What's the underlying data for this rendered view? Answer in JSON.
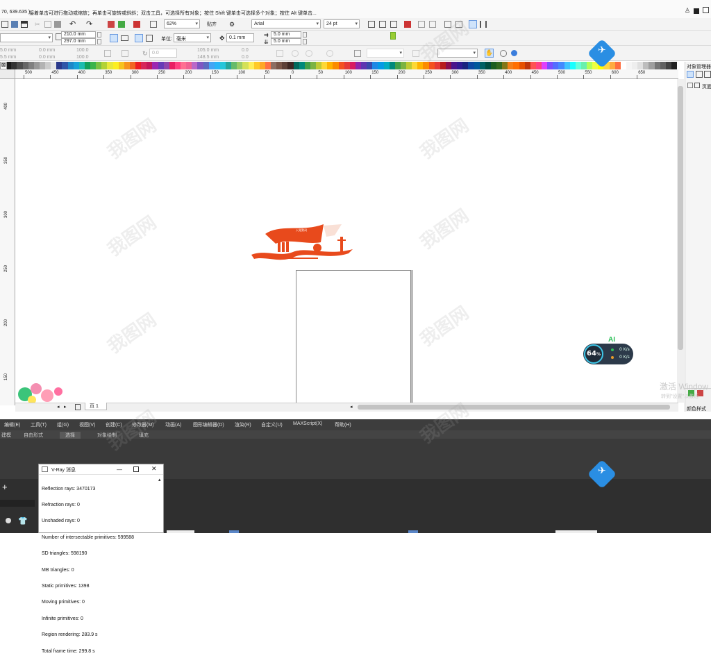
{
  "status_bar": {
    "coords": "70, 639.635 )",
    "hint": "接着单击可进行拖动或缩放；再单击可旋转或斜斜；双击工具，可选择所有对象；按住 Shift 键单击可选择多个对象；按住 Alt 键单击..."
  },
  "toolbar": {
    "zoom": "62%",
    "snap_label": "贴齐",
    "font_name": "Arial",
    "font_size": "24 pt"
  },
  "property_bar": {
    "width": "210.0 mm",
    "height": "297.0 mm",
    "unit_label": "单位:",
    "unit_value": "毫米",
    "nudge": "0.1 mm",
    "dup_x": "5.0 mm",
    "dup_y": "5.0 mm"
  },
  "property_bar2": {
    "val_a": "5.0 mm",
    "val_b": "5.5 mm",
    "val_c": "0.0 mm",
    "val_d": "0.0 mm",
    "val_e": "100.0",
    "val_f": "100.0",
    "val_g": "0.0",
    "val_h": "105.0 mm",
    "val_i": "148.5 mm",
    "val_j": "0.0",
    "val_k": "0.0"
  },
  "ruler_h": [
    "500",
    "450",
    "400",
    "350",
    "300",
    "250",
    "200",
    "150",
    "100",
    "50",
    "0",
    "50",
    "100",
    "150",
    "200",
    "250",
    "300",
    "350",
    "400",
    "450",
    "500",
    "550",
    "600",
    "650"
  ],
  "ruler_v": [
    "400",
    "350",
    "300",
    "250",
    "200",
    "150"
  ],
  "palette_colors": [
    "#000000",
    "#1a1a1a",
    "#333333",
    "#4d4d4d",
    "#666666",
    "#808080",
    "#999999",
    "#b3b3b3",
    "#cccccc",
    "#e6e6e6",
    "#2b3a8c",
    "#3056a8",
    "#1e88c8",
    "#17a2d8",
    "#1bbcb0",
    "#12a15a",
    "#3cb44b",
    "#7cc242",
    "#b2d235",
    "#e8e83a",
    "#fcee21",
    "#f7c31e",
    "#f7941d",
    "#f26522",
    "#ed1c24",
    "#d7265a",
    "#c2185b",
    "#9c27b0",
    "#673ab7",
    "#8e44ad",
    "#e91e63",
    "#ff4081",
    "#ff6f91",
    "#f06292",
    "#ba68c8",
    "#7e57c2",
    "#5c6bc0",
    "#42a5f5",
    "#29b6f6",
    "#26c6da",
    "#26a69a",
    "#66bb6a",
    "#9ccc65",
    "#d4e157",
    "#ffee58",
    "#ffca28",
    "#ffa726",
    "#ff7043",
    "#8d6e63",
    "#795548",
    "#5d4037",
    "#3e2723",
    "#00695c",
    "#00897b",
    "#43a047",
    "#7cb342",
    "#c0ca33",
    "#fdd835",
    "#ffb300",
    "#fb8c00",
    "#f4511e",
    "#e53935",
    "#d81b60",
    "#8e24aa",
    "#5e35b1",
    "#3949ab",
    "#1e88e5",
    "#039be5",
    "#00acc1",
    "#00897b",
    "#43a047",
    "#7cb342",
    "#c0ca33",
    "#fdd835",
    "#ffb300",
    "#fb8c00",
    "#f4511e",
    "#e53935",
    "#b71c1c",
    "#880e4f",
    "#4a148c",
    "#311b92",
    "#1a237e",
    "#0d47a1",
    "#01579b",
    "#006064",
    "#004d40",
    "#1b5e20",
    "#33691e",
    "#827717",
    "#f57f17",
    "#ff6f00",
    "#e65100",
    "#bf360c",
    "#ff5252",
    "#ff4081",
    "#e040fb",
    "#7c4dff",
    "#536dfe",
    "#448aff",
    "#40c4ff",
    "#18ffff",
    "#64ffda",
    "#69f0ae",
    "#b2ff59",
    "#eeff41",
    "#ffff00",
    "#ffd740",
    "#ffab40",
    "#ff6e40",
    "#ffffff",
    "#f5f5f5",
    "#eeeeee",
    "#e0e0e0",
    "#bdbdbd",
    "#9e9e9e",
    "#757575",
    "#616161",
    "#424242",
    "#212121"
  ],
  "page_tab": "页 1",
  "docker": {
    "title": "对象管理器",
    "page_label": "页面",
    "color_styles": "颜色样式"
  },
  "max_menu": [
    "编辑(E)",
    "工具(T)",
    "组(G)",
    "视图(V)",
    "创建(C)",
    "修改器(M)",
    "动画(A)",
    "图形编辑器(D)",
    "渲染(R)",
    "自定义(U)",
    "MAXScript(X)",
    "帮助(H)"
  ],
  "max_ribbon": [
    "建模",
    "自由形式",
    "选择",
    "对象绘制",
    "填充"
  ],
  "vray": {
    "title": "V-Ray 消息",
    "lines": [
      "Reflection rays: 3470173",
      "Refraction rays: 0",
      "Unshaded rays: 0",
      "Number of intersectable primitives: 599588",
      "SD triangles: 598190",
      "MB triangles: 0",
      "Static primitives: 1398",
      "Moving primitives: 0",
      "Infinite primitives: 0",
      "Region rendering: 283.9 s",
      "Total frame time: 299.8 s"
    ]
  },
  "net_widget": {
    "percent": "64",
    "unit": "%",
    "up": "0 K/s",
    "down": "0 K/s",
    "ai": "AI"
  },
  "windows_activation": {
    "line1": "激活 Window",
    "line2": "转到\"设置\"以激活"
  },
  "artwork": {
    "flag_title": "入党誓词",
    "accent": "#e84a1c"
  },
  "watermark": "我图网"
}
